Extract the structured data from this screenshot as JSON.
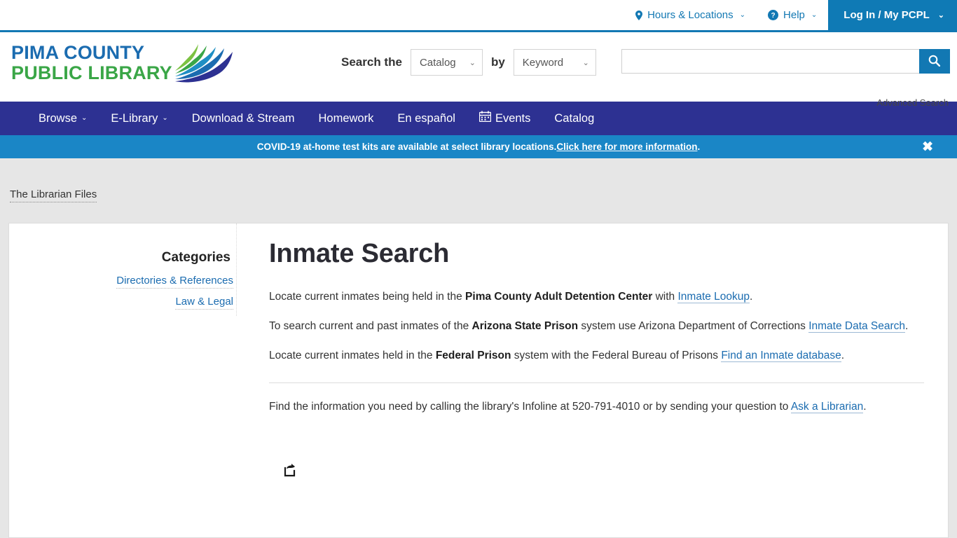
{
  "utility_bar": {
    "hours_locations": "Hours & Locations",
    "help": "Help",
    "login": "Log In / My PCPL",
    "caret": "⌄"
  },
  "header": {
    "logo_line1": "PIMA COUNTY",
    "logo_line2": "PUBLIC LIBRARY",
    "search_the_label": "Search the",
    "by_label": "by",
    "catalog_value": "Catalog",
    "keyword_value": "Keyword",
    "search_input_value": "",
    "search_placeholder": "",
    "advanced_search": "Advanced Search",
    "search_icon": "search-icon"
  },
  "nav": {
    "items": [
      {
        "label": "Browse",
        "has_caret": true
      },
      {
        "label": "E-Library",
        "has_caret": true
      },
      {
        "label": "Download & Stream",
        "has_caret": false
      },
      {
        "label": "Homework",
        "has_caret": false
      },
      {
        "label": "En español",
        "has_caret": false
      },
      {
        "label": "Events",
        "has_caret": false,
        "icon": "calendar-icon"
      },
      {
        "label": "Catalog",
        "has_caret": false
      }
    ]
  },
  "alert": {
    "text": "COVID-19 at-home test kits are available at select library locations. ",
    "link_text": "Click here for more information",
    "trailing": ".",
    "close_label": "✖"
  },
  "breadcrumb": {
    "label": "The Librarian Files"
  },
  "sidebar": {
    "title": "Categories",
    "links": [
      "Directories & References",
      "Law & Legal"
    ]
  },
  "main": {
    "title": "Inmate Search",
    "paragraph1": {
      "p1_a": "Locate current inmates being held in the ",
      "p1_bold": "Pima County Adult Detention Center",
      "p1_b": " with ",
      "p1_link": "Inmate Lookup",
      "p1_c": "."
    },
    "paragraph2": {
      "p2_a": "To search current and past inmates of the ",
      "p2_bold": "Arizona State Prison",
      "p2_b": " system use Arizona Department of Corrections ",
      "p2_link": "Inmate Data Search",
      "p2_c": "."
    },
    "paragraph3": {
      "p3_a": "Locate current inmates held in the ",
      "p3_bold": "Federal Prison",
      "p3_b": " system with the Federal Bureau of Prisons ",
      "p3_link": "Find an Inmate database",
      "p3_c": "."
    },
    "paragraph4": {
      "p4_a": "Find the information you need by calling the library's Infoline at 520-791-4010 or by sending your question to ",
      "p4_link": "Ask a Librarian",
      "p4_b": "."
    },
    "share_icon": "share-icon"
  },
  "colors": {
    "utility_blue": "#1278b3",
    "login_blue": "#0f7ab5",
    "nav_navy": "#2d3192",
    "alert_blue": "#1a86c6",
    "link_blue": "#1b6cb0",
    "logo_green": "#3aa647",
    "page_bg": "#e6e6e6"
  }
}
